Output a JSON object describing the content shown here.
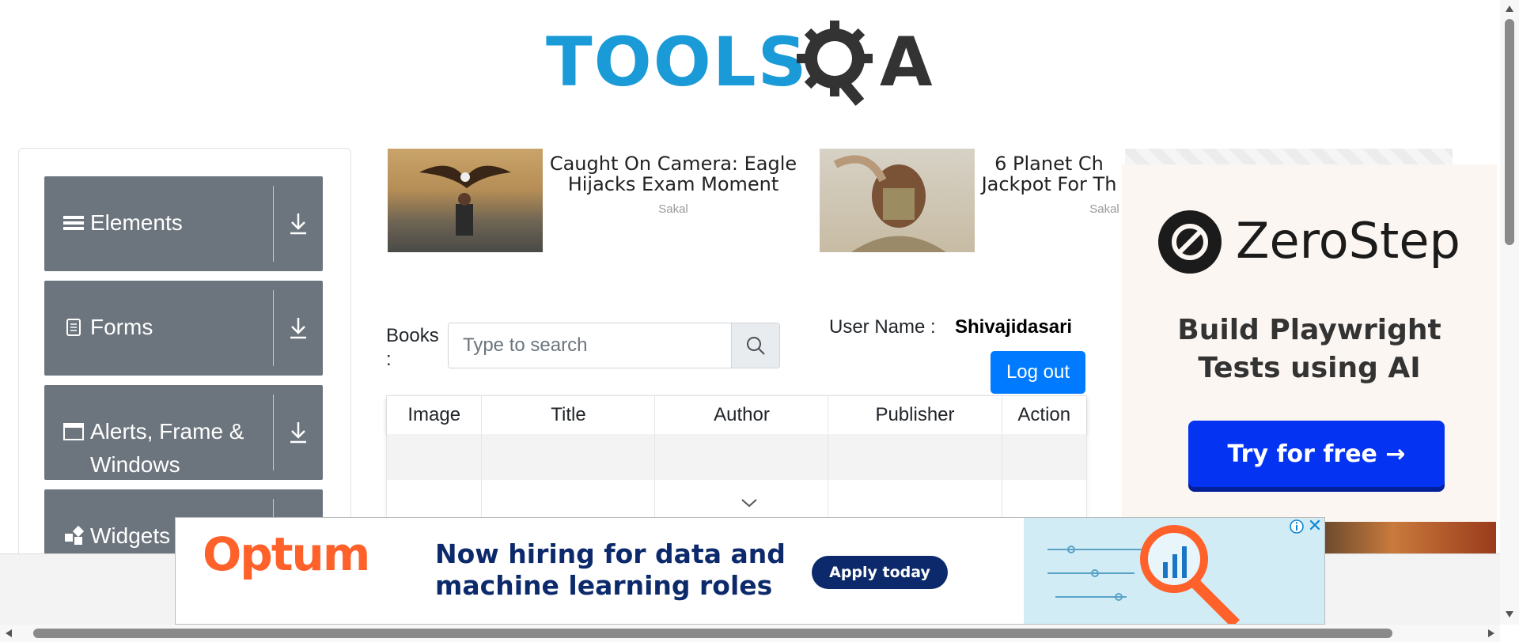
{
  "brand": {
    "logo_text": "TOOLS",
    "logo_suffix": "A"
  },
  "sidebar": {
    "groups": [
      {
        "label": "Elements",
        "icon": "hamburger-icon"
      },
      {
        "label": "Forms",
        "icon": "document-icon"
      },
      {
        "label": "Alerts, Frame &",
        "label2": "Windows",
        "icon": "window-icon"
      },
      {
        "label": "Widgets",
        "icon": "widgets-icon"
      }
    ]
  },
  "ads_top": [
    {
      "title1": "Caught On Camera: Eagle",
      "title2": "Hijacks Exam Moment",
      "source": "Sakal"
    },
    {
      "title1": "6 Planet Ch",
      "title2": "Jackpot For Th",
      "source": "Sakal"
    }
  ],
  "books": {
    "label": "Books",
    "label_colon": ":",
    "search_placeholder": "Type to search",
    "user_label": "User Name :",
    "user_name": "Shivajidasari",
    "logout_label": "Log out",
    "columns": [
      "Image",
      "Title",
      "Author",
      "Publisher",
      "Action"
    ]
  },
  "ad_right": {
    "name": "ZeroStep",
    "tagline1": "Build Playwright",
    "tagline2": "Tests using AI",
    "cta": "Try for free →"
  },
  "banner": {
    "brand": "Optum",
    "headline1": "Now hiring for data and",
    "headline2": "machine learning roles",
    "cta": "Apply today",
    "info": "ⓘ",
    "close": "✕"
  },
  "colors": {
    "brand_blue": "#1a9bd7",
    "sidebar_gray": "#6c757d",
    "primary": "#007bff",
    "optum_orange": "#ff612b",
    "zerostep_blue": "#0533f2"
  }
}
